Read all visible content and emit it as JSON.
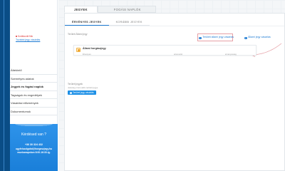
{
  "sidebar": {
    "user_warning": "Korlátozott fiók",
    "user_link": "További jegy vásárlás",
    "menu_items": [
      {
        "label": "Áttekintő",
        "active": false
      },
      {
        "label": "Személyes adatok",
        "active": false
      },
      {
        "label": "Jegyek és fogási naplók",
        "active": true
      },
      {
        "label": "Tagságok és engedélyek",
        "active": false
      },
      {
        "label": "Vásárlási előzmények",
        "active": false
      },
      {
        "label": "Dokumentumok",
        "active": false
      }
    ],
    "help": {
      "title": "Kérdésed van ?",
      "phone": "+36 30 324 432",
      "email": "ugyfelszolgalat@horgaszjegy.hu",
      "hours": "munkanapokon 8:00-16:30-ig."
    }
  },
  "main": {
    "top_tabs": [
      "JEGYEK",
      "FOGÁSI NAPLÓK"
    ],
    "sub_tabs": [
      "ÉRVÉNYES JEGYEK",
      "KORÁBBI JEGYEK"
    ],
    "state_section": {
      "label": "Területi Állami jegy",
      "action_buy_state": "Területi állami jegy vásárlás",
      "action_buy_regional": "Állami jegy vásárlás",
      "ticket": {
        "title": "Állami horgászjegy",
        "col1": "Érvényes",
        "col2": "azonosító",
        "col3": "érvényesség"
      }
    },
    "regional_section": {
      "label": "Területi jegyek",
      "info": "Jelenleg nincs aktív területi jegye",
      "button": "Területi jegy vásárlás"
    }
  },
  "colors": {
    "accent": "#1e7bd3",
    "sidebar_dark": "#0a4d86",
    "help_box": "#1a7fd9",
    "highlight": "#e6a0a6",
    "ticket_icon": "#f0a020"
  }
}
